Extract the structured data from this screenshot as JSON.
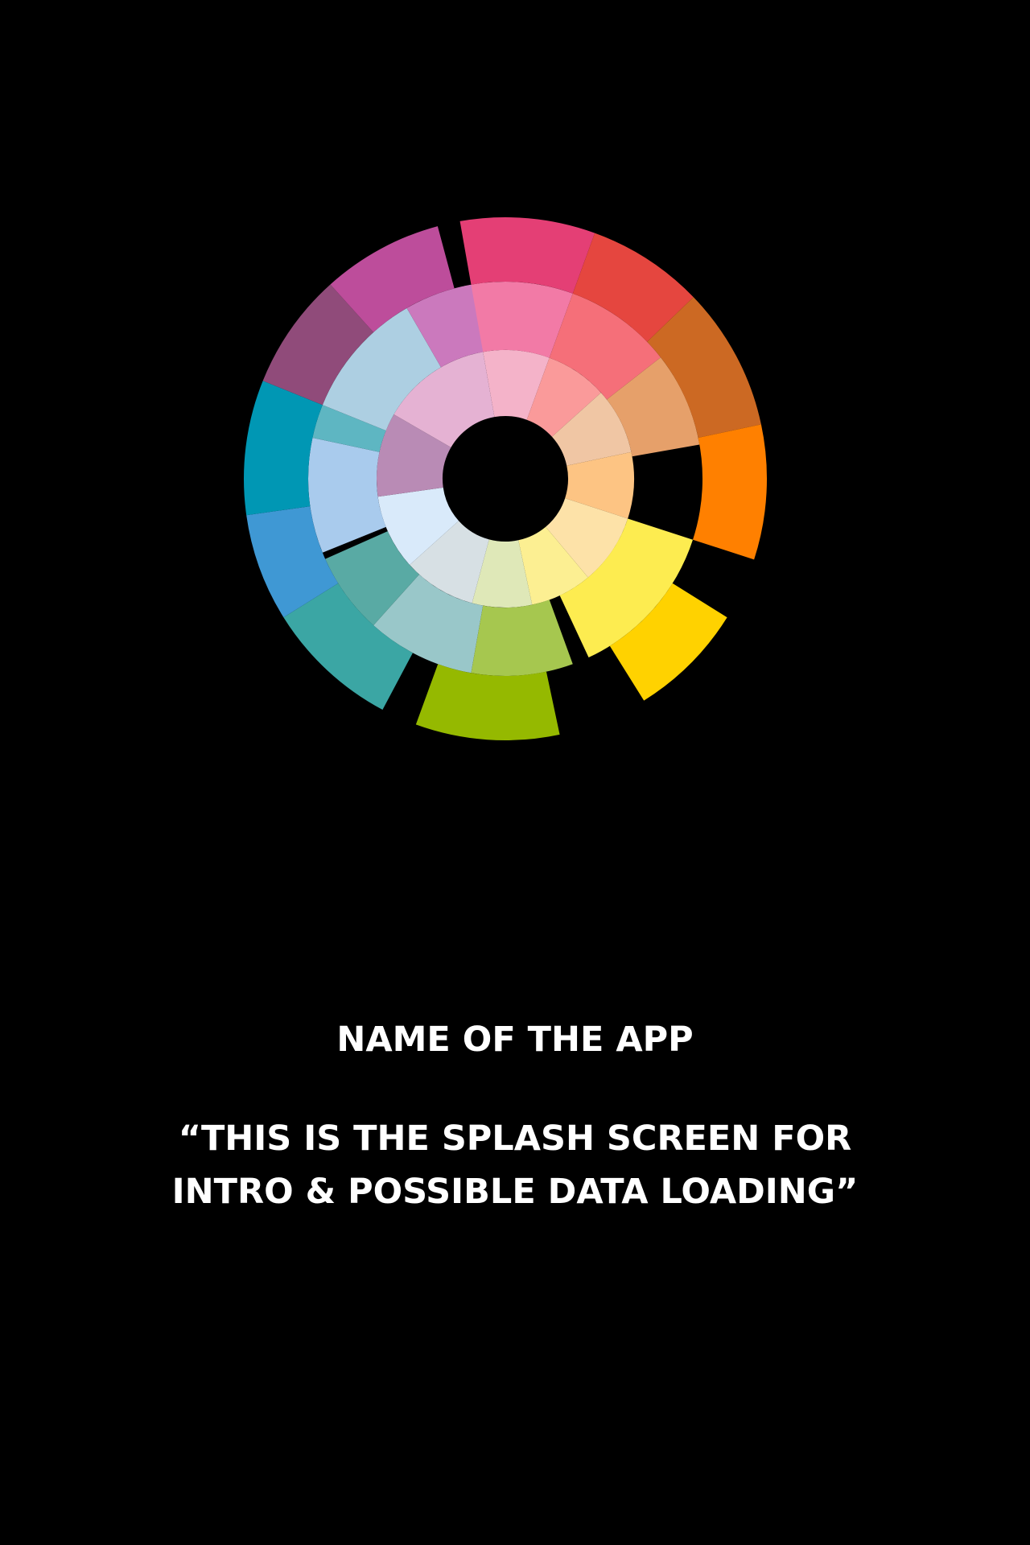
{
  "splash": {
    "app_name": "NAME OF THE APP",
    "tagline": "“THIS IS THE SPLASH SCREEN FOR INTRO & POSSIBLE DATA LOADING”",
    "background": "#000000",
    "text_color": "#ffffff"
  },
  "logo": {
    "icon": "color-wheel-logo-icon",
    "segment_colors": {
      "inner": [
        "#f4b3c9",
        "#fa9a9a",
        "#f0c6a4",
        "#fdc483",
        "#fde2a8",
        "#fcef92",
        "#dfe8b8",
        "#d7e0e4",
        "#d9eafa",
        "#b98bb5",
        "#e5b2d3"
      ],
      "middle": [
        "#f27aa6",
        "#f56f79",
        "#e6a06a",
        "#a9cbed",
        "#5eb6c2",
        "#99c7c9",
        "#a6c74f",
        "#fdec50",
        "#59aaa4",
        "#adcfe2",
        "#cb79bd"
      ],
      "outer": [
        "#e43f75",
        "#e5463f",
        "#cc6923",
        "#ff8000",
        "#ffd200",
        "#3ba6a4",
        "#95b900",
        "#3f98d4",
        "#0097b4",
        "#904b7a",
        "#bd4d9b"
      ]
    }
  }
}
